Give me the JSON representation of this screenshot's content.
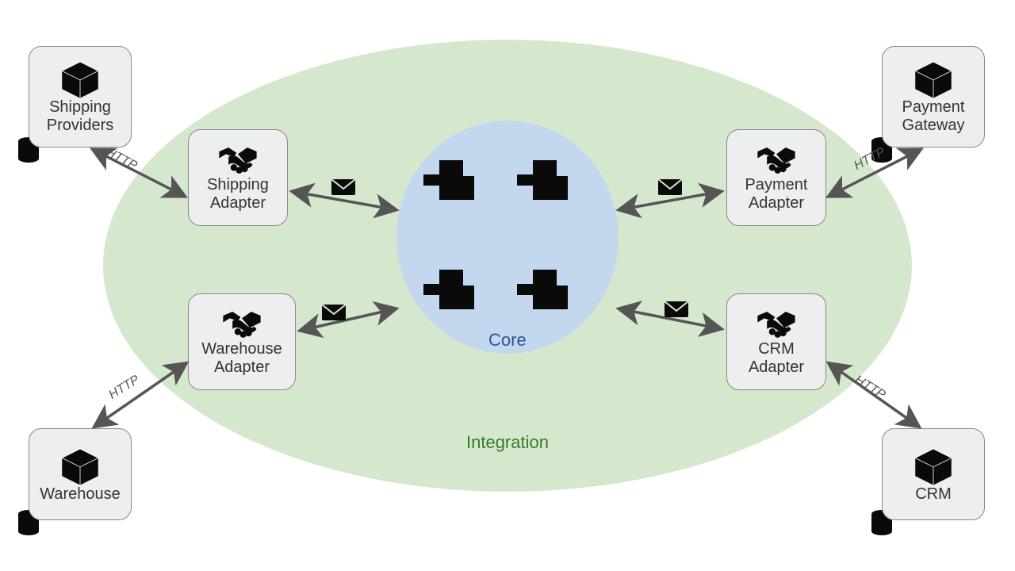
{
  "regions": {
    "integration": {
      "label": "Integration",
      "color": "#d5e8ce",
      "label_color": "#3a7a2a"
    },
    "core": {
      "label": "Core",
      "color": "#c3d8ef",
      "label_color": "#2a5599"
    }
  },
  "external": {
    "shipping_providers": {
      "label": "Shipping\nProviders",
      "icon": "package"
    },
    "payment_gateway": {
      "label": "Payment\nGateway",
      "icon": "package"
    },
    "warehouse": {
      "label": "Warehouse",
      "icon": "package"
    },
    "crm": {
      "label": "CRM",
      "icon": "package"
    }
  },
  "adapters": {
    "shipping": {
      "label": "Shipping\nAdapter",
      "icon": "handshake"
    },
    "payment": {
      "label": "Payment\nAdapter",
      "icon": "handshake"
    },
    "warehouse": {
      "label": "Warehouse\nAdapter",
      "icon": "handshake"
    },
    "crm": {
      "label": "CRM\nAdapter",
      "icon": "handshake"
    }
  },
  "edges": {
    "http": "HTTP",
    "message_icon": "envelope"
  },
  "core_ports": 4
}
